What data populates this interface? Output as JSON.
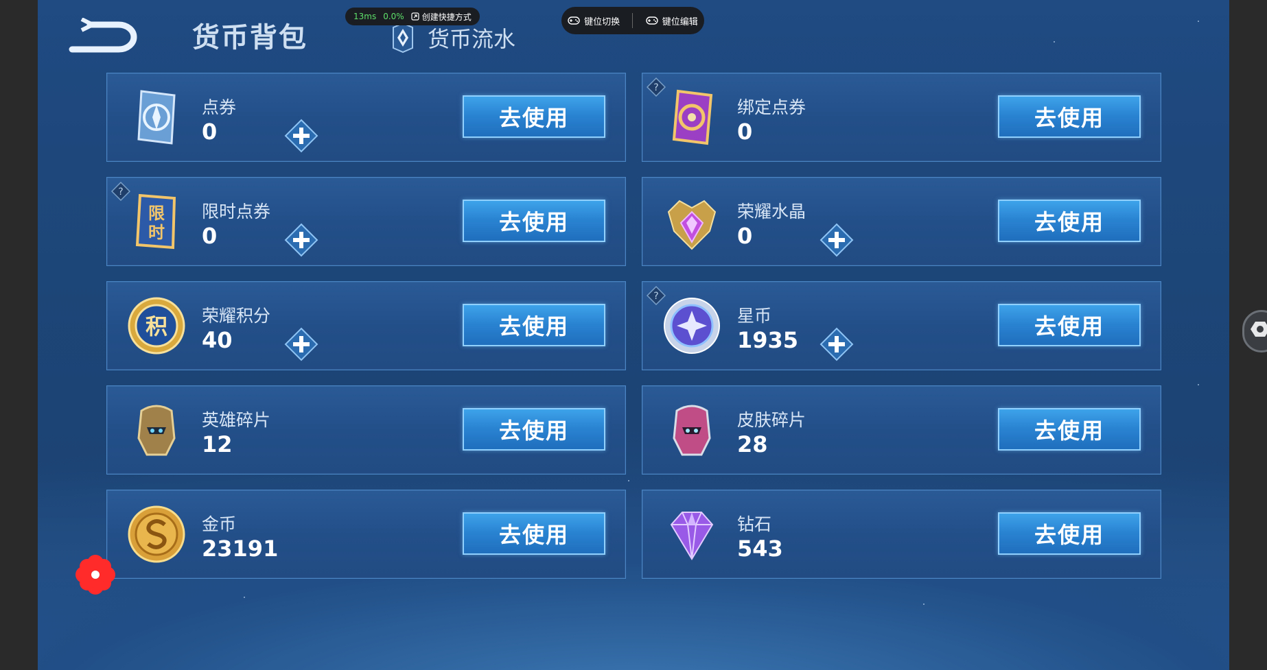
{
  "header": {
    "title": "货币背包",
    "tab_flow_label": "货币流水"
  },
  "perf": {
    "latency": "13ms",
    "loss": "0.0%",
    "shortcut_label": "创建快捷方式"
  },
  "keys": {
    "switch_label": "键位切换",
    "edit_label": "键位编辑"
  },
  "cards": [
    {
      "name": "点券",
      "value": "0",
      "button": "去使用",
      "icon": "coupon-icon"
    },
    {
      "name": "绑定点券",
      "value": "0",
      "button": "去使用",
      "icon": "bound-coupon-icon"
    },
    {
      "name": "限时点券",
      "value": "0",
      "button": "去使用",
      "icon": "limited-coupon-icon",
      "badge": "限时"
    },
    {
      "name": "荣耀水晶",
      "value": "0",
      "button": "去使用",
      "icon": "glory-crystal-icon"
    },
    {
      "name": "荣耀积分",
      "value": "40",
      "button": "去使用",
      "icon": "glory-points-icon",
      "badge": "积"
    },
    {
      "name": "星币",
      "value": "1935",
      "button": "去使用",
      "icon": "star-coin-icon"
    },
    {
      "name": "英雄碎片",
      "value": "12",
      "button": "去使用",
      "icon": "hero-fragment-icon"
    },
    {
      "name": "皮肤碎片",
      "value": "28",
      "button": "去使用",
      "icon": "skin-fragment-icon"
    },
    {
      "name": "金币",
      "value": "23191",
      "button": "去使用",
      "icon": "gold-coin-icon"
    },
    {
      "name": "钻石",
      "value": "543",
      "button": "去使用",
      "icon": "diamond-icon"
    }
  ],
  "colors": {
    "accent": "#2a84d2",
    "text": "#d8e6f6",
    "card_border": "#4a86c6"
  }
}
